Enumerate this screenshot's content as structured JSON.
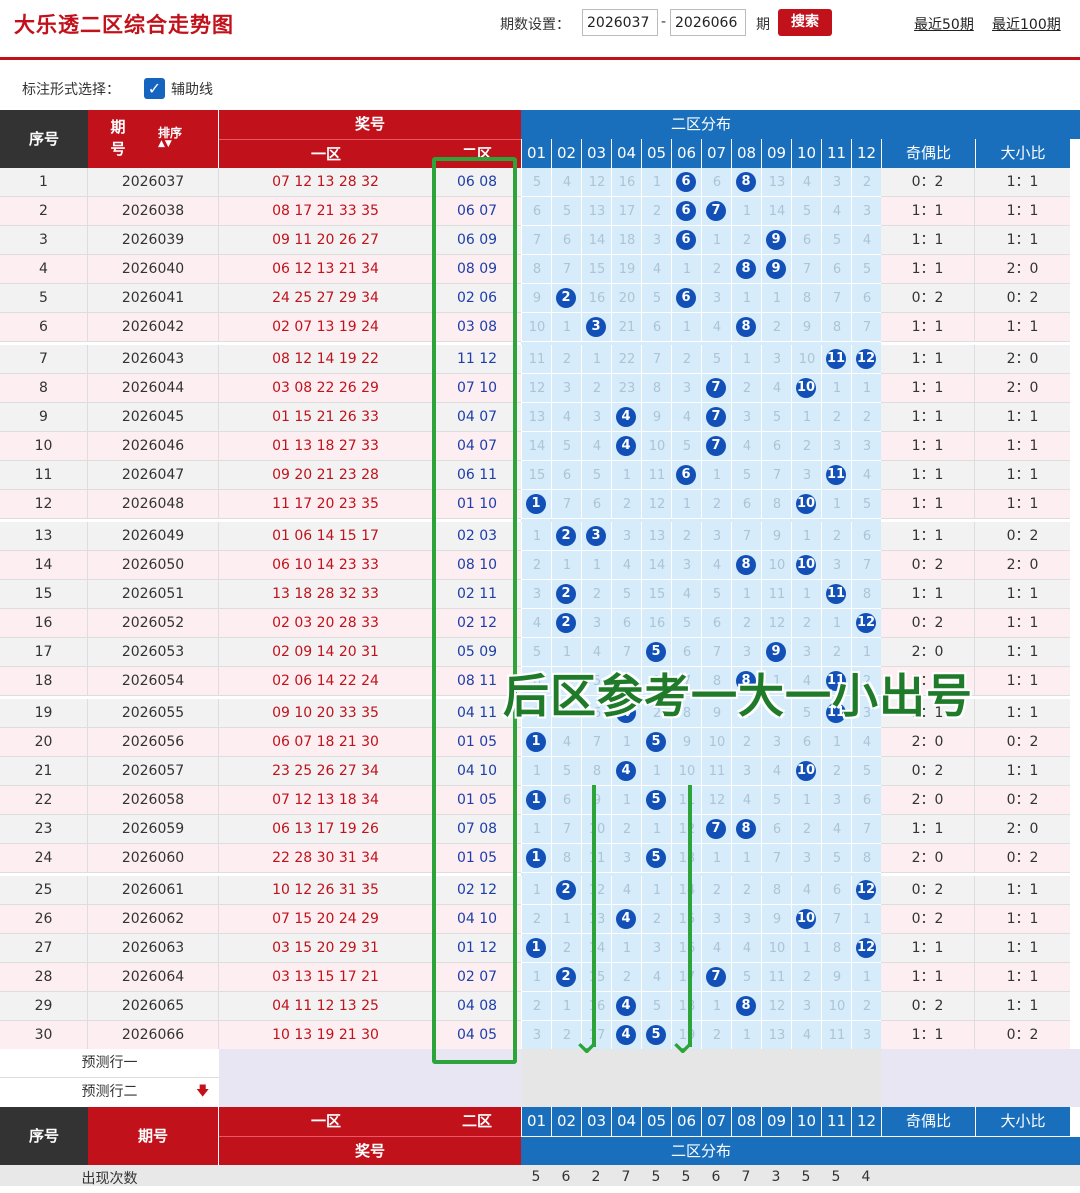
{
  "header": {
    "title": "大乐透二区综合走势图",
    "period_label": "期数设置：",
    "period_from": "2026037",
    "period_sep": "-",
    "period_to": "2026066",
    "period_unit": "期",
    "search_label": "搜索",
    "link50": "最近50期",
    "link100": "最近100期"
  },
  "options": {
    "label": "标注形式选择：",
    "aux_line": "辅助线",
    "checked": true
  },
  "table_head": {
    "seq": "序号",
    "period": "期号",
    "sort": "排序",
    "award": "奖号",
    "zone1": "一区",
    "zone2": "二区",
    "dist": "二区分布",
    "odd_even": "奇偶比",
    "big_small": "大小比",
    "cols": [
      "01",
      "02",
      "03",
      "04",
      "05",
      "06",
      "07",
      "08",
      "09",
      "10",
      "11",
      "12"
    ]
  },
  "rows": [
    {
      "seq": "1",
      "period": "2026037",
      "z1": "07 12 13 28 32",
      "z2": "06 08",
      "dist": [
        "5",
        "4",
        "12",
        "16",
        "1",
        "6",
        "6",
        "8",
        "13",
        "4",
        "3",
        "2"
      ],
      "hit": [
        6,
        8
      ],
      "oe": "0：2",
      "bs": "1：1"
    },
    {
      "seq": "2",
      "period": "2026038",
      "z1": "08 17 21 33 35",
      "z2": "06 07",
      "dist": [
        "6",
        "5",
        "13",
        "17",
        "2",
        "6",
        "7",
        "1",
        "14",
        "5",
        "4",
        "3"
      ],
      "hit": [
        6,
        7
      ],
      "oe": "1：1",
      "bs": "1：1"
    },
    {
      "seq": "3",
      "period": "2026039",
      "z1": "09 11 20 26 27",
      "z2": "06 09",
      "dist": [
        "7",
        "6",
        "14",
        "18",
        "3",
        "6",
        "1",
        "2",
        "9",
        "6",
        "5",
        "4"
      ],
      "hit": [
        6,
        9
      ],
      "oe": "1：1",
      "bs": "1：1"
    },
    {
      "seq": "4",
      "period": "2026040",
      "z1": "06 12 13 21 34",
      "z2": "08 09",
      "dist": [
        "8",
        "7",
        "15",
        "19",
        "4",
        "1",
        "2",
        "8",
        "9",
        "7",
        "6",
        "5"
      ],
      "hit": [
        8,
        9
      ],
      "oe": "1：1",
      "bs": "2：0"
    },
    {
      "seq": "5",
      "period": "2026041",
      "z1": "24 25 27 29 34",
      "z2": "02 06",
      "dist": [
        "9",
        "2",
        "16",
        "20",
        "5",
        "6",
        "3",
        "1",
        "1",
        "8",
        "7",
        "6"
      ],
      "hit": [
        2,
        6
      ],
      "oe": "0：2",
      "bs": "0：2"
    },
    {
      "seq": "6",
      "period": "2026042",
      "z1": "02 07 13 19 24",
      "z2": "03 08",
      "dist": [
        "10",
        "1",
        "3",
        "21",
        "6",
        "1",
        "4",
        "8",
        "2",
        "9",
        "8",
        "7"
      ],
      "hit": [
        3,
        8
      ],
      "oe": "1：1",
      "bs": "1：1"
    },
    {
      "seq": "7",
      "period": "2026043",
      "z1": "08 12 14 19 22",
      "z2": "11 12",
      "dist": [
        "11",
        "2",
        "1",
        "22",
        "7",
        "2",
        "5",
        "1",
        "3",
        "10",
        "11",
        "12"
      ],
      "hit": [
        11,
        12
      ],
      "oe": "1：1",
      "bs": "2：0"
    },
    {
      "seq": "8",
      "period": "2026044",
      "z1": "03 08 22 26 29",
      "z2": "07 10",
      "dist": [
        "12",
        "3",
        "2",
        "23",
        "8",
        "3",
        "7",
        "2",
        "4",
        "10",
        "1",
        "1"
      ],
      "hit": [
        7,
        10
      ],
      "oe": "1：1",
      "bs": "2：0"
    },
    {
      "seq": "9",
      "period": "2026045",
      "z1": "01 15 21 26 33",
      "z2": "04 07",
      "dist": [
        "13",
        "4",
        "3",
        "4",
        "9",
        "4",
        "7",
        "3",
        "5",
        "1",
        "2",
        "2"
      ],
      "hit": [
        4,
        7
      ],
      "oe": "1：1",
      "bs": "1：1"
    },
    {
      "seq": "10",
      "period": "2026046",
      "z1": "01 13 18 27 33",
      "z2": "04 07",
      "dist": [
        "14",
        "5",
        "4",
        "4",
        "10",
        "5",
        "7",
        "4",
        "6",
        "2",
        "3",
        "3"
      ],
      "hit": [
        4,
        7
      ],
      "oe": "1：1",
      "bs": "1：1"
    },
    {
      "seq": "11",
      "period": "2026047",
      "z1": "09 20 21 23 28",
      "z2": "06 11",
      "dist": [
        "15",
        "6",
        "5",
        "1",
        "11",
        "6",
        "1",
        "5",
        "7",
        "3",
        "11",
        "4"
      ],
      "hit": [
        6,
        11
      ],
      "oe": "1：1",
      "bs": "1：1"
    },
    {
      "seq": "12",
      "period": "2026048",
      "z1": "11 17 20 23 35",
      "z2": "01 10",
      "dist": [
        "1",
        "7",
        "6",
        "2",
        "12",
        "1",
        "2",
        "6",
        "8",
        "10",
        "1",
        "5"
      ],
      "hit": [
        1,
        10
      ],
      "oe": "1：1",
      "bs": "1：1"
    },
    {
      "seq": "13",
      "period": "2026049",
      "z1": "01 06 14 15 17",
      "z2": "02 03",
      "dist": [
        "1",
        "2",
        "3",
        "3",
        "13",
        "2",
        "3",
        "7",
        "9",
        "1",
        "2",
        "6"
      ],
      "hit": [
        2,
        3
      ],
      "oe": "1：1",
      "bs": "0：2"
    },
    {
      "seq": "14",
      "period": "2026050",
      "z1": "06 10 14 23 33",
      "z2": "08 10",
      "dist": [
        "2",
        "1",
        "1",
        "4",
        "14",
        "3",
        "4",
        "8",
        "10",
        "10",
        "3",
        "7"
      ],
      "hit": [
        8,
        10
      ],
      "oe": "0：2",
      "bs": "2：0"
    },
    {
      "seq": "15",
      "period": "2026051",
      "z1": "13 18 28 32 33",
      "z2": "02 11",
      "dist": [
        "3",
        "2",
        "2",
        "5",
        "15",
        "4",
        "5",
        "1",
        "11",
        "1",
        "11",
        "8"
      ],
      "hit": [
        2,
        11
      ],
      "oe": "1：1",
      "bs": "1：1"
    },
    {
      "seq": "16",
      "period": "2026052",
      "z1": "02 03 20 28 33",
      "z2": "02 12",
      "dist": [
        "4",
        "2",
        "3",
        "6",
        "16",
        "5",
        "6",
        "2",
        "12",
        "2",
        "1",
        "12"
      ],
      "hit": [
        2,
        12
      ],
      "oe": "0：2",
      "bs": "1：1"
    },
    {
      "seq": "17",
      "period": "2026053",
      "z1": "02 09 14 20 31",
      "z2": "05 09",
      "dist": [
        "5",
        "1",
        "4",
        "7",
        "5",
        "6",
        "7",
        "3",
        "9",
        "3",
        "2",
        "1"
      ],
      "hit": [
        5,
        9
      ],
      "oe": "2：0",
      "bs": "1：1"
    },
    {
      "seq": "18",
      "period": "2026054",
      "z1": "02 06 14 22 24",
      "z2": "08 11",
      "dist": [
        "6",
        "2",
        "5",
        "8",
        "1",
        "7",
        "8",
        "8",
        "1",
        "4",
        "11",
        "2"
      ],
      "hit": [
        8,
        11
      ],
      "oe": "1：1",
      "bs": "1：1"
    },
    {
      "seq": "19",
      "period": "2026055",
      "z1": "09 10 20 33 35",
      "z2": "04 11",
      "dist": [
        "7",
        "3",
        "6",
        "4",
        "2",
        "8",
        "9",
        "1",
        "2",
        "5",
        "11",
        "3"
      ],
      "hit": [
        4,
        11
      ],
      "oe": "1：1",
      "bs": "1：1"
    },
    {
      "seq": "20",
      "period": "2026056",
      "z1": "06 07 18 21 30",
      "z2": "01 05",
      "dist": [
        "1",
        "4",
        "7",
        "1",
        "5",
        "9",
        "10",
        "2",
        "3",
        "6",
        "1",
        "4"
      ],
      "hit": [
        1,
        5
      ],
      "oe": "2：0",
      "bs": "0：2"
    },
    {
      "seq": "21",
      "period": "2026057",
      "z1": "23 25 26 27 34",
      "z2": "04 10",
      "dist": [
        "1",
        "5",
        "8",
        "4",
        "1",
        "10",
        "11",
        "3",
        "4",
        "10",
        "2",
        "5"
      ],
      "hit": [
        4,
        10
      ],
      "oe": "0：2",
      "bs": "1：1"
    },
    {
      "seq": "22",
      "period": "2026058",
      "z1": "07 12 13 18 34",
      "z2": "01 05",
      "dist": [
        "1",
        "6",
        "9",
        "1",
        "5",
        "11",
        "12",
        "4",
        "5",
        "1",
        "3",
        "6"
      ],
      "hit": [
        1,
        5
      ],
      "oe": "2：0",
      "bs": "0：2"
    },
    {
      "seq": "23",
      "period": "2026059",
      "z1": "06 13 17 19 26",
      "z2": "07 08",
      "dist": [
        "1",
        "7",
        "10",
        "2",
        "1",
        "12",
        "7",
        "8",
        "6",
        "2",
        "4",
        "7"
      ],
      "hit": [
        7,
        8
      ],
      "oe": "1：1",
      "bs": "2：0"
    },
    {
      "seq": "24",
      "period": "2026060",
      "z1": "22 28 30 31 34",
      "z2": "01 05",
      "dist": [
        "1",
        "8",
        "11",
        "3",
        "5",
        "13",
        "1",
        "1",
        "7",
        "3",
        "5",
        "8"
      ],
      "hit": [
        1,
        5
      ],
      "oe": "2：0",
      "bs": "0：2"
    },
    {
      "seq": "25",
      "period": "2026061",
      "z1": "10 12 26 31 35",
      "z2": "02 12",
      "dist": [
        "1",
        "2",
        "12",
        "4",
        "1",
        "14",
        "2",
        "2",
        "8",
        "4",
        "6",
        "12"
      ],
      "hit": [
        2,
        12
      ],
      "oe": "0：2",
      "bs": "1：1"
    },
    {
      "seq": "26",
      "period": "2026062",
      "z1": "07 15 20 24 29",
      "z2": "04 10",
      "dist": [
        "2",
        "1",
        "13",
        "4",
        "2",
        "15",
        "3",
        "3",
        "9",
        "10",
        "7",
        "1"
      ],
      "hit": [
        4,
        10
      ],
      "oe": "0：2",
      "bs": "1：1"
    },
    {
      "seq": "27",
      "period": "2026063",
      "z1": "03 15 20 29 31",
      "z2": "01 12",
      "dist": [
        "1",
        "2",
        "14",
        "1",
        "3",
        "16",
        "4",
        "4",
        "10",
        "1",
        "8",
        "12"
      ],
      "hit": [
        1,
        12
      ],
      "oe": "1：1",
      "bs": "1：1"
    },
    {
      "seq": "28",
      "period": "2026064",
      "z1": "03 13 15 17 21",
      "z2": "02 07",
      "dist": [
        "1",
        "2",
        "15",
        "2",
        "4",
        "17",
        "7",
        "5",
        "11",
        "2",
        "9",
        "1"
      ],
      "hit": [
        2,
        7
      ],
      "oe": "1：1",
      "bs": "1：1"
    },
    {
      "seq": "29",
      "period": "2026065",
      "z1": "04 11 12 13 25",
      "z2": "04 08",
      "dist": [
        "2",
        "1",
        "16",
        "4",
        "5",
        "18",
        "1",
        "8",
        "12",
        "3",
        "10",
        "2"
      ],
      "hit": [
        4,
        8
      ],
      "oe": "0：2",
      "bs": "1：1"
    },
    {
      "seq": "30",
      "period": "2026066",
      "z1": "10 13 19 21 30",
      "z2": "04 05",
      "dist": [
        "3",
        "2",
        "17",
        "4",
        "5",
        "19",
        "2",
        "1",
        "13",
        "4",
        "11",
        "3"
      ],
      "hit": [
        4,
        5
      ],
      "oe": "1：1",
      "bs": "0：2"
    }
  ],
  "predict": {
    "row1": "预测行一",
    "row2": "预测行二"
  },
  "footer": {
    "seq": "序号",
    "period": "期号",
    "zone1": "一区",
    "zone2": "二区",
    "award": "奖号",
    "dist": "二区分布",
    "odd_even": "奇偶比",
    "big_small": "大小比",
    "count_label": "出现次数",
    "counts": [
      "5",
      "6",
      "2",
      "7",
      "5",
      "5",
      "6",
      "7",
      "3",
      "5",
      "5",
      "4"
    ]
  },
  "overlay": {
    "text": "后区参考一大一小出号"
  },
  "colors": {
    "red": "#c1121c",
    "blue": "#1a6fbd",
    "ball": "#1250b8",
    "green": "#2ca43a"
  }
}
